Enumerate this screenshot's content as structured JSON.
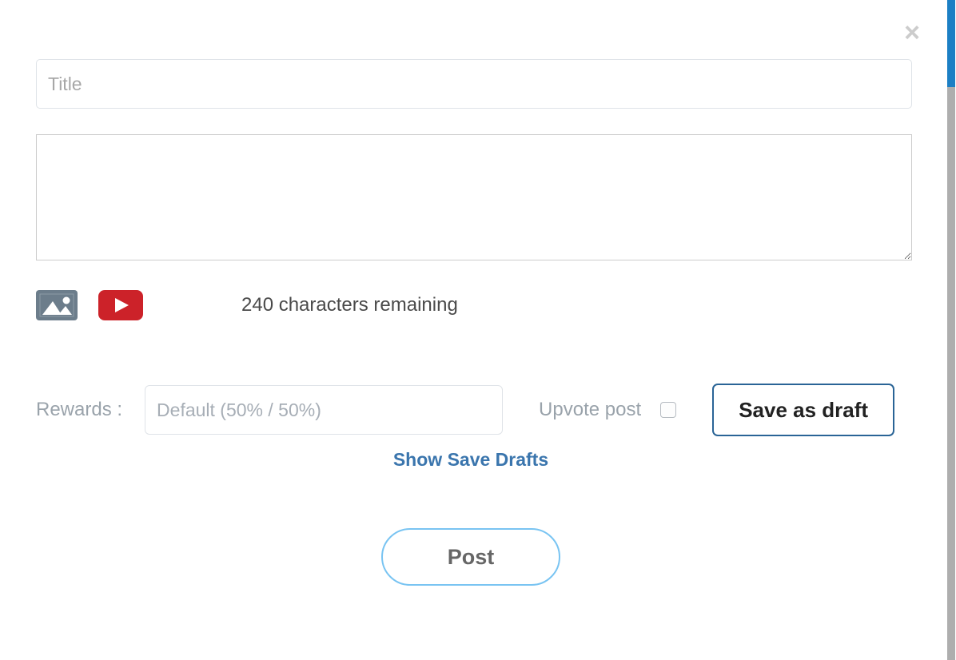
{
  "modal": {
    "close_icon": "close-icon",
    "close_glyph": "×"
  },
  "form": {
    "title_field": {
      "value": "",
      "placeholder": "Title"
    },
    "body_field": {
      "value": "",
      "placeholder": ""
    },
    "media": {
      "image_icon": "image-icon",
      "youtube_icon": "youtube-icon"
    },
    "character_counter": "240 characters remaining",
    "characters_remaining": 240,
    "rewards": {
      "label": "Rewards :",
      "selected_option": "Default (50% / 50%)",
      "options": [
        "Default (50% / 50%)"
      ]
    },
    "upvote": {
      "label": "Upvote post",
      "checked": false
    },
    "save_draft_label": "Save as draft",
    "show_drafts_label": "Show Save Drafts",
    "post_label": "Post"
  },
  "scrollbar": {
    "thumb_color": "#1c7fc4",
    "track_color": "#aeaeae"
  },
  "colors": {
    "link": "#3a75ad",
    "save_draft_border": "#2a6496",
    "post_border": "#79c4f2",
    "image_icon_bg": "#6c7d8b",
    "youtube_icon_bg": "#cc2229",
    "placeholder_text": "#a7aeb6"
  }
}
